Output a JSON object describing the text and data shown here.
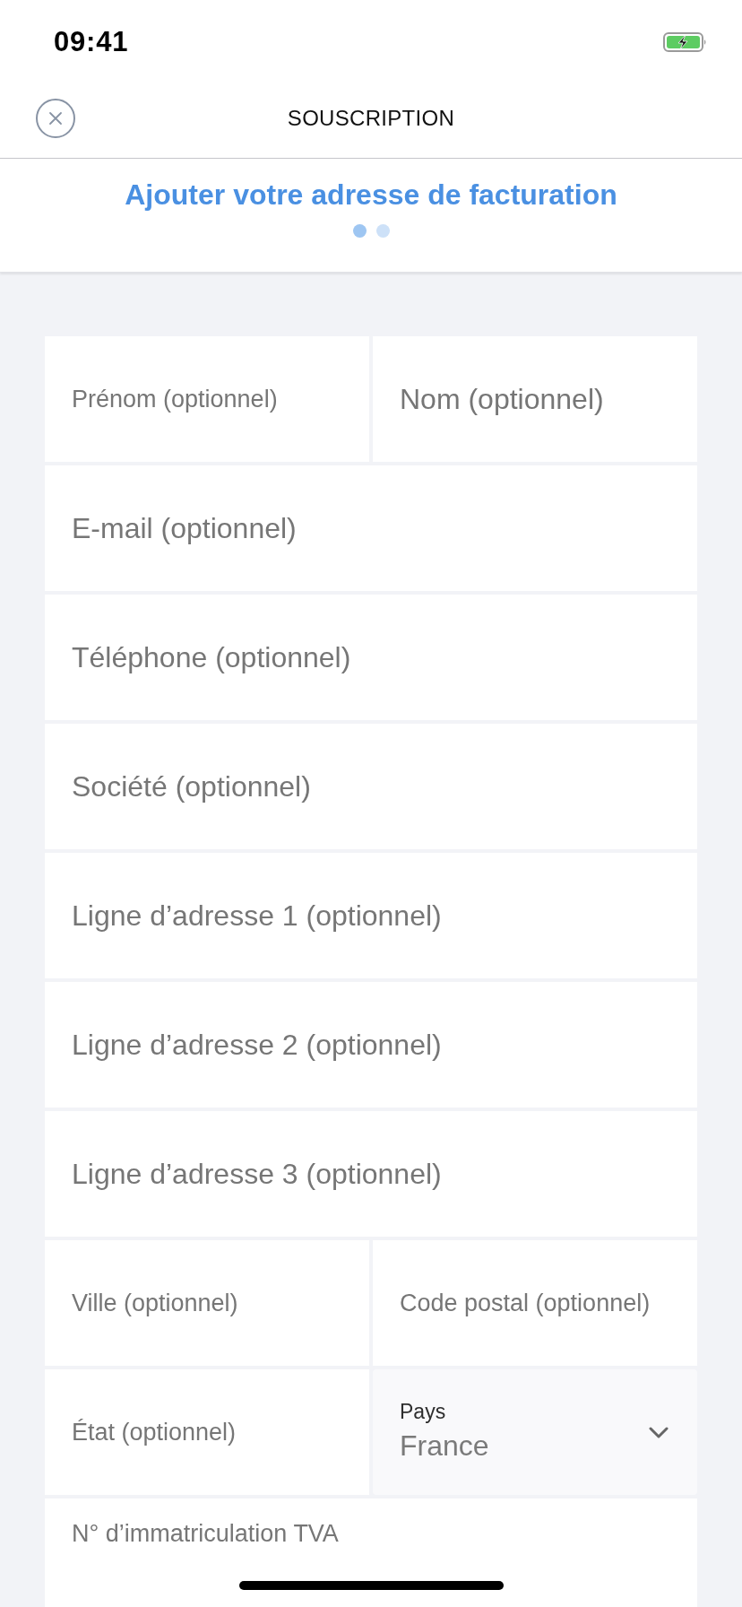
{
  "status_bar": {
    "time": "09:41"
  },
  "nav": {
    "title": "SOUSCRIPTION"
  },
  "header": {
    "title": "Ajouter votre adresse de facturation",
    "steps": [
      {
        "selected": true
      },
      {
        "selected": false
      }
    ]
  },
  "form": {
    "rows": [
      {
        "fields": [
          {
            "kind": "text",
            "placeholder": "Prénom (optionnel)"
          },
          {
            "kind": "text",
            "placeholder": "Nom (optionnel)"
          }
        ]
      },
      {
        "fields": [
          {
            "kind": "text",
            "placeholder": "E-mail (optionnel)"
          }
        ]
      },
      {
        "fields": [
          {
            "kind": "text",
            "placeholder": "Téléphone (optionnel)"
          }
        ]
      },
      {
        "fields": [
          {
            "kind": "text",
            "placeholder": "Société (optionnel)"
          }
        ]
      },
      {
        "fields": [
          {
            "kind": "text",
            "placeholder": "Ligne d’adresse 1 (optionnel)"
          }
        ]
      },
      {
        "fields": [
          {
            "kind": "text",
            "placeholder": "Ligne d’adresse 2 (optionnel)"
          }
        ]
      },
      {
        "fields": [
          {
            "kind": "text",
            "placeholder": "Ligne d’adresse 3 (optionnel)"
          }
        ]
      },
      {
        "fields": [
          {
            "kind": "text",
            "placeholder": "Ville (optionnel)"
          },
          {
            "kind": "text",
            "placeholder": "Code postal (optionnel)"
          }
        ]
      },
      {
        "fields": [
          {
            "kind": "text",
            "placeholder": "État (optionnel)"
          },
          {
            "kind": "select",
            "label": "Pays",
            "value": "France"
          }
        ]
      },
      {
        "fields": [
          {
            "kind": "text",
            "placeholder": "N° d’immatriculation TVA"
          }
        ]
      }
    ]
  }
}
